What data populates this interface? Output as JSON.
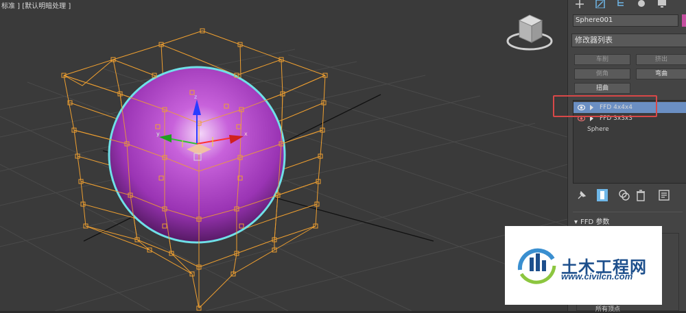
{
  "viewport": {
    "label": "标准 ] [默认明暗处理 ]"
  },
  "command_panel": {
    "tabs": [
      "create-icon",
      "modify-icon",
      "hierarchy-icon",
      "motion-icon",
      "display-icon"
    ],
    "object_name": "Sphere001",
    "object_color": "#c44fa0",
    "modifier_list_label": "修改器列表",
    "buttons": {
      "lathe": "车削",
      "extrude": "挤出",
      "chamfer": "倒角",
      "bend": "弯曲",
      "twist": "扭曲"
    },
    "stack": [
      {
        "label": "FFD 4x4x4",
        "selected": true
      },
      {
        "label": "FFD 3x3x3",
        "selected": false
      },
      {
        "label": "Sphere",
        "selected": false
      }
    ],
    "toolbar_icons": [
      "pin-stack-icon",
      "show-end-result-icon",
      "make-unique-icon",
      "remove-modifier-icon",
      "configure-modifier-sets-icon"
    ],
    "rollout_title": "FFD 参数",
    "bottom_text": "所有顶点"
  },
  "watermark": {
    "title": "土木工程网",
    "url": "www.civilcn.com"
  },
  "colors": {
    "viewport_bg": "#3a3a3a",
    "lattice": "#f0a030",
    "sphere": "#b347c9",
    "selection_ring": "#6fe0e8",
    "highlight": "#d94848",
    "selected_row": "#6b8fc3"
  }
}
